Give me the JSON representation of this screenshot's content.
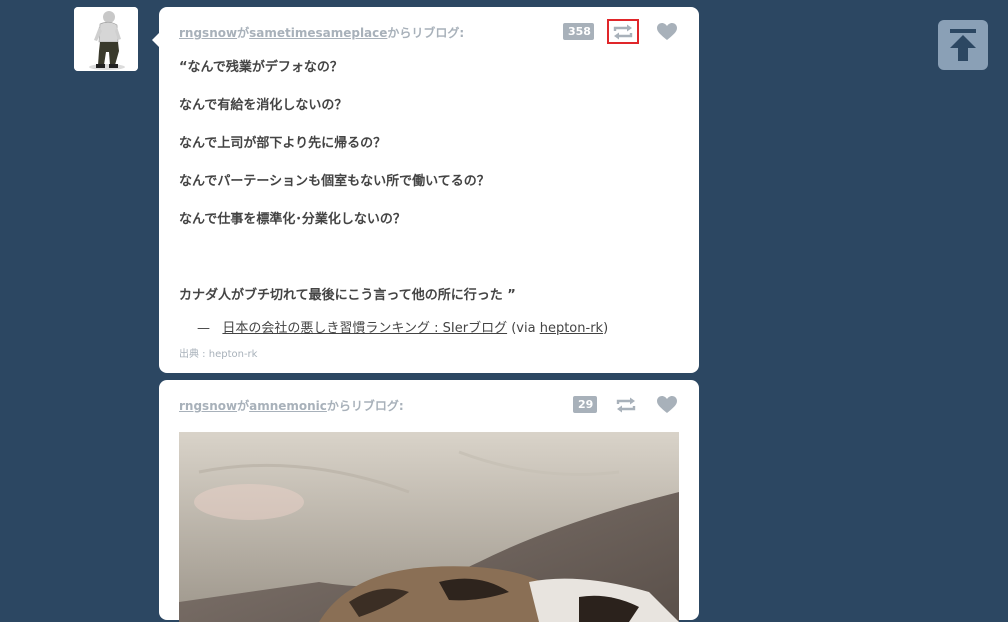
{
  "posts": [
    {
      "reblogger": "rngsnow",
      "connector": "が",
      "source_blog": "sametimesameplace",
      "reblog_suffix": "からリブログ:",
      "note_count": "358",
      "quote_lines": [
        "“なんで残業がデフォなの？",
        "なんで有給を消化しないの？",
        "なんで上司が部下より先に帰るの？",
        "なんでパーテーションも個室もない所で働いてるの？",
        "なんで仕事を標準化･分業化しないの？",
        "",
        "カナダ人がブチ切れて最後にこう言って他の所に行った ”"
      ],
      "source_dash": "—",
      "source_title": "日本の会社の悪しき習慣ランキング : SIerブログ",
      "via_prefix": "(via ",
      "via_name": "hepton-rk",
      "via_suffix": ")",
      "credit": "出典 : hepton-rk"
    },
    {
      "reblogger": "rngsnow",
      "connector": "が",
      "source_blog": "amnemonic",
      "reblog_suffix": "からリブログ:",
      "note_count": "29"
    }
  ],
  "icons": {
    "reblog": "reblog-icon",
    "like": "heart-icon",
    "back_to_top": "arrow-up-to-top-icon"
  },
  "colors": {
    "background": "#2c4762",
    "muted_text": "#a8b1ba",
    "focus_outline": "#e0262a"
  }
}
